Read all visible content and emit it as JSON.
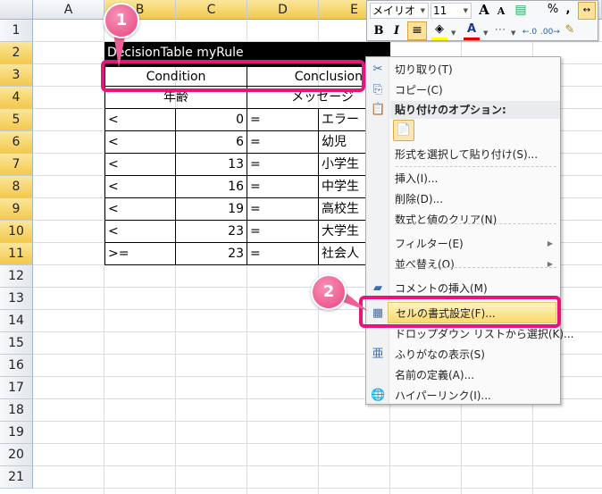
{
  "columns": [
    "A",
    "B",
    "C",
    "D",
    "E"
  ],
  "rows": [
    "1",
    "2",
    "3",
    "4",
    "5",
    "6",
    "7",
    "8",
    "9",
    "10",
    "11",
    "12",
    "13",
    "14",
    "15",
    "16",
    "17",
    "18",
    "19",
    "20",
    "21"
  ],
  "table": {
    "title": "DecisionTable myRule",
    "condition": "Condition",
    "conclusion": "Conclusion",
    "condition_sub": "年齢",
    "conclusion_sub": "メッセージ",
    "data": [
      [
        "<",
        "0",
        "=",
        "エラー"
      ],
      [
        "<",
        "6",
        "=",
        "幼児"
      ],
      [
        "<",
        "13",
        "=",
        "小学生"
      ],
      [
        "<",
        "16",
        "=",
        "中学生"
      ],
      [
        "<",
        "19",
        "=",
        "高校生"
      ],
      [
        "<",
        "23",
        "=",
        "大学生"
      ],
      [
        ">=",
        "23",
        "=",
        "社会人"
      ]
    ]
  },
  "mini_toolbar": {
    "font": "メイリオ",
    "size": "11",
    "grow": "A",
    "shrink": "A",
    "percent": "%",
    "comma": ",",
    "bold": "B",
    "italic": "I",
    "font_color": "A",
    "fill_color": "#ffff00",
    "text_color": "#e00000"
  },
  "context_menu": {
    "items": [
      {
        "label": "切り取り(T)",
        "icon": "scissors-icon"
      },
      {
        "label": "コピー(C)",
        "icon": "copy-icon"
      },
      {
        "label": "貼り付けのオプション:",
        "icon": "paste-icon"
      },
      {
        "label": "形式を選択して貼り付け(S)..."
      },
      {
        "label": "挿入(I)..."
      },
      {
        "label": "削除(D)..."
      },
      {
        "label": "数式と値のクリア(N)"
      },
      {
        "label": "フィルター(E)"
      },
      {
        "label": "並べ替え(O)"
      },
      {
        "label": "コメントの挿入(M)",
        "icon": "comment-icon"
      },
      {
        "label": "セルの書式設定(F)...",
        "icon": "format-cells-icon"
      },
      {
        "label": "ドロップダウン リストから選択(K)..."
      },
      {
        "label": "ふりがなの表示(S)",
        "icon": "furigana-icon"
      },
      {
        "label": "名前の定義(A)..."
      },
      {
        "label": "ハイパーリンク(I)...",
        "icon": "hyperlink-icon"
      }
    ]
  },
  "callouts": [
    "1",
    "2"
  ],
  "accent": "#e6157e"
}
